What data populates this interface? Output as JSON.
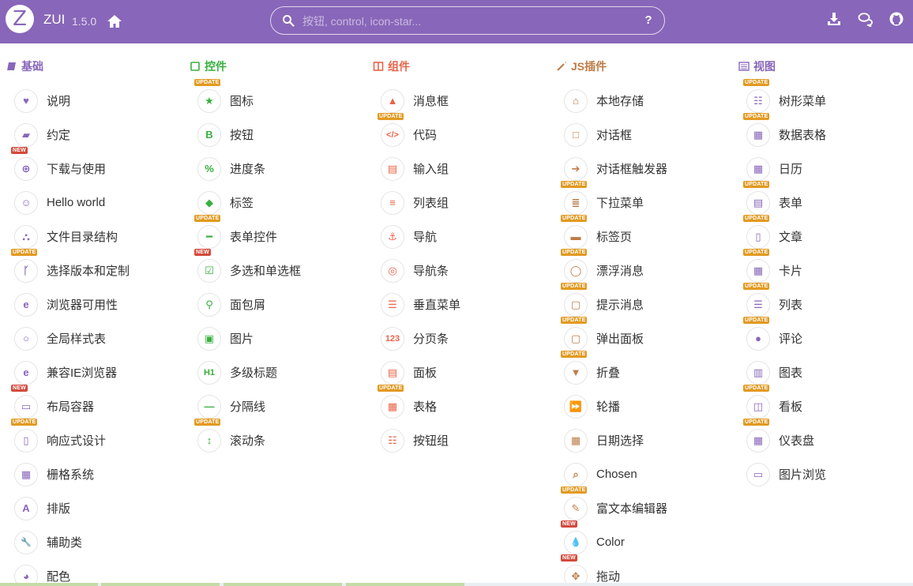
{
  "header": {
    "logo": "Z",
    "brand": "ZUI",
    "version": "1.5.0",
    "search_placeholder": "按钮, control, icon-star..."
  },
  "columns": [
    {
      "title": "基础",
      "color": "#8866b9",
      "items": [
        {
          "label": "说明",
          "icon": "heart-icon",
          "glyph": "♥",
          "badge": ""
        },
        {
          "label": "约定",
          "icon": "book-icon",
          "glyph": "▰",
          "badge": ""
        },
        {
          "label": "下载与使用",
          "icon": "download-circle-icon",
          "glyph": "⊕",
          "badge": "NEW"
        },
        {
          "label": "Hello world",
          "icon": "smile-icon",
          "glyph": "☺",
          "badge": ""
        },
        {
          "label": "文件目录结构",
          "icon": "sitemap-icon",
          "glyph": "⛬",
          "badge": ""
        },
        {
          "label": "选择版本和定制",
          "icon": "code-fork-icon",
          "glyph": "ᚴ",
          "badge": "UPDATE"
        },
        {
          "label": "浏览器可用性",
          "icon": "ie-icon",
          "glyph": "e",
          "badge": ""
        },
        {
          "label": "全局样式表",
          "icon": "circle-o-icon",
          "glyph": "○",
          "badge": ""
        },
        {
          "label": "兼容IE浏览器",
          "icon": "ie-icon",
          "glyph": "e",
          "badge": ""
        },
        {
          "label": "布局容器",
          "icon": "window-icon",
          "glyph": "▭",
          "badge": "NEW"
        },
        {
          "label": "响应式设计",
          "icon": "mobile-icon",
          "glyph": "▯",
          "badge": "UPDATE"
        },
        {
          "label": "栅格系统",
          "icon": "th-icon",
          "glyph": "▦",
          "badge": ""
        },
        {
          "label": "排版",
          "icon": "font-icon",
          "glyph": "A",
          "badge": ""
        },
        {
          "label": "辅助类",
          "icon": "wrench-icon",
          "glyph": "🔧",
          "badge": ""
        },
        {
          "label": "配色",
          "icon": "palette-icon",
          "glyph": "◕",
          "badge": ""
        }
      ]
    },
    {
      "title": "控件",
      "color": "#38b03f",
      "items": [
        {
          "label": "图标",
          "icon": "star-icon",
          "glyph": "★",
          "badge": "UPDATE"
        },
        {
          "label": "按钮",
          "icon": "bold-icon",
          "glyph": "B",
          "badge": ""
        },
        {
          "label": "进度条",
          "icon": "percent-icon",
          "glyph": "%",
          "badge": ""
        },
        {
          "label": "标签",
          "icon": "tag-icon",
          "glyph": "◆",
          "badge": ""
        },
        {
          "label": "表单控件",
          "icon": "minus-square-icon",
          "glyph": "━",
          "badge": "UPDATE"
        },
        {
          "label": "多选和单选框",
          "icon": "check-square-icon",
          "glyph": "☑",
          "badge": "NEW"
        },
        {
          "label": "面包屑",
          "icon": "map-marker-icon",
          "glyph": "⚲",
          "badge": ""
        },
        {
          "label": "图片",
          "icon": "picture-icon",
          "glyph": "▣",
          "badge": ""
        },
        {
          "label": "多级标题",
          "icon": "header-icon",
          "glyph": "H1",
          "badge": ""
        },
        {
          "label": "分隔线",
          "icon": "hr-icon",
          "glyph": "—",
          "badge": ""
        },
        {
          "label": "滚动条",
          "icon": "resize-v-icon",
          "glyph": "↕",
          "badge": "UPDATE"
        }
      ]
    },
    {
      "title": "组件",
      "color": "#ea644a",
      "items": [
        {
          "label": "消息框",
          "icon": "warning-icon",
          "glyph": "▲",
          "badge": ""
        },
        {
          "label": "代码",
          "icon": "code-icon",
          "glyph": "</>",
          "badge": "UPDATE"
        },
        {
          "label": "输入组",
          "icon": "keyboard-icon",
          "glyph": "▤",
          "badge": ""
        },
        {
          "label": "列表组",
          "icon": "list-icon",
          "glyph": "≡",
          "badge": ""
        },
        {
          "label": "导航",
          "icon": "anchor-icon",
          "glyph": "⚓",
          "badge": ""
        },
        {
          "label": "导航条",
          "icon": "compass-icon",
          "glyph": "◎",
          "badge": ""
        },
        {
          "label": "垂直菜单",
          "icon": "list-ul-icon",
          "glyph": "☰",
          "badge": ""
        },
        {
          "label": "分页条",
          "icon": "pager-icon",
          "glyph": "123",
          "badge": ""
        },
        {
          "label": "面板",
          "icon": "list-alt-icon",
          "glyph": "▤",
          "badge": ""
        },
        {
          "label": "表格",
          "icon": "table-icon",
          "glyph": "▦",
          "badge": "UPDATE"
        },
        {
          "label": "按钮组",
          "icon": "th-list-icon",
          "glyph": "☷",
          "badge": ""
        }
      ]
    },
    {
      "title": "JS插件",
      "color": "#bd7b46",
      "items": [
        {
          "label": "本地存储",
          "icon": "hdd-icon",
          "glyph": "⌂",
          "badge": ""
        },
        {
          "label": "对话框",
          "icon": "square-o-icon",
          "glyph": "□",
          "badge": ""
        },
        {
          "label": "对话框触发器",
          "icon": "sign-in-icon",
          "glyph": "➔",
          "badge": ""
        },
        {
          "label": "下拉菜单",
          "icon": "bars-icon",
          "glyph": "≣",
          "badge": "UPDATE"
        },
        {
          "label": "标签页",
          "icon": "credit-card-icon",
          "glyph": "▬",
          "badge": "UPDATE"
        },
        {
          "label": "漂浮消息",
          "icon": "comment-o-icon",
          "glyph": "◯",
          "badge": "UPDATE"
        },
        {
          "label": "提示消息",
          "icon": "chat-icon",
          "glyph": "▢",
          "badge": "UPDATE"
        },
        {
          "label": "弹出面板",
          "icon": "chat-dots-icon",
          "glyph": "▢",
          "badge": "UPDATE"
        },
        {
          "label": "折叠",
          "icon": "caret-square-icon",
          "glyph": "▼",
          "badge": "UPDATE"
        },
        {
          "label": "轮播",
          "icon": "fast-forward-icon",
          "glyph": "⏩",
          "badge": ""
        },
        {
          "label": "日期选择",
          "icon": "calendar-icon",
          "glyph": "▦",
          "badge": ""
        },
        {
          "label": "Chosen",
          "icon": "search-icon",
          "glyph": "⌕",
          "badge": ""
        },
        {
          "label": "富文本编辑器",
          "icon": "edit-icon",
          "glyph": "✎",
          "badge": "UPDATE"
        },
        {
          "label": "Color",
          "icon": "tint-icon",
          "glyph": "💧",
          "badge": "NEW"
        },
        {
          "label": "拖动",
          "icon": "move-icon",
          "glyph": "✥",
          "badge": "NEW"
        }
      ]
    },
    {
      "title": "视图",
      "color": "#8866b9",
      "items": [
        {
          "label": "树形菜单",
          "icon": "tree-list-icon",
          "glyph": "☷",
          "badge": "UPDATE"
        },
        {
          "label": "数据表格",
          "icon": "table-icon",
          "glyph": "▦",
          "badge": "UPDATE"
        },
        {
          "label": "日历",
          "icon": "calendar-icon",
          "glyph": "▦",
          "badge": ""
        },
        {
          "label": "表单",
          "icon": "form-icon",
          "glyph": "▤",
          "badge": "UPDATE"
        },
        {
          "label": "文章",
          "icon": "file-text-icon",
          "glyph": "▯",
          "badge": "UPDATE"
        },
        {
          "label": "卡片",
          "icon": "th-icon",
          "glyph": "▦",
          "badge": "UPDATE"
        },
        {
          "label": "列表",
          "icon": "list-icon",
          "glyph": "☰",
          "badge": "UPDATE"
        },
        {
          "label": "评论",
          "icon": "comments-icon",
          "glyph": "●",
          "badge": "UPDATE"
        },
        {
          "label": "图表",
          "icon": "bar-chart-icon",
          "glyph": "▥",
          "badge": ""
        },
        {
          "label": "看板",
          "icon": "columns-icon",
          "glyph": "◫",
          "badge": "UPDATE"
        },
        {
          "label": "仪表盘",
          "icon": "dashboard-icon",
          "glyph": "▦",
          "badge": "UPDATE"
        },
        {
          "label": "图片浏览",
          "icon": "film-icon",
          "glyph": "▭",
          "badge": ""
        }
      ]
    }
  ]
}
